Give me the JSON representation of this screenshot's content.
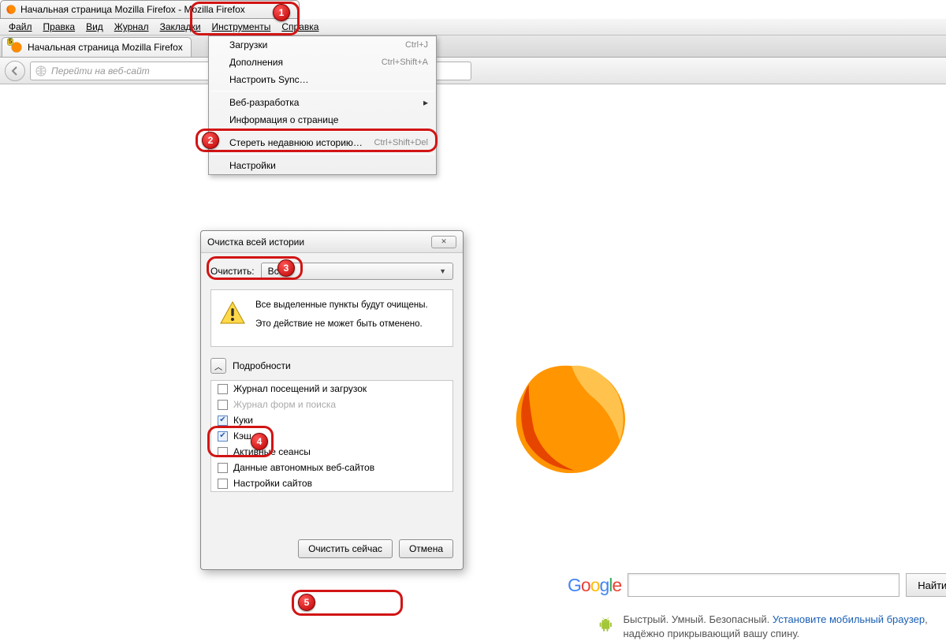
{
  "window": {
    "title": "Начальная страница Mozilla Firefox - Mozilla Firefox"
  },
  "menubar": {
    "file": "Файл",
    "edit": "Правка",
    "view": "Вид",
    "history": "Журнал",
    "bookmarks": "Закладки",
    "tools": "Инструменты",
    "help": "Справка"
  },
  "tab": {
    "label": "Начальная страница Mozilla Firefox",
    "badge": "5"
  },
  "urlbar": {
    "placeholder": "Перейти на веб-сайт"
  },
  "dropdown": {
    "downloads": {
      "label": "Загрузки",
      "shortcut": "Ctrl+J"
    },
    "addons": {
      "label": "Дополнения",
      "shortcut": "Ctrl+Shift+A"
    },
    "sync": {
      "label": "Настроить Sync…"
    },
    "webdev": {
      "label": "Веб-разработка"
    },
    "pageinfo": {
      "label": "Информация о странице"
    },
    "clearhist": {
      "label": "Стереть недавнюю историю…",
      "shortcut": "Ctrl+Shift+Del"
    },
    "prefs": {
      "label": "Настройки"
    }
  },
  "dialog": {
    "title": "Очистка всей истории",
    "clear_label": "Очистить:",
    "range": "Всё",
    "warn1": "Все выделенные пункты будут очищены.",
    "warn2": "Это действие не может быть отменено.",
    "details": "Подробности",
    "items": {
      "browsing": "Журнал посещений и загрузок",
      "forms": "Журнал форм и поиска",
      "cookies": "Куки",
      "cache": "Кэш",
      "sessions": "Активные сеансы",
      "offline": "Данные автономных веб-сайтов",
      "siteprefs": "Настройки сайтов"
    },
    "ok": "Очистить сейчас",
    "cancel": "Отмена"
  },
  "home": {
    "search_btn": "Найти",
    "promo_text": "Быстрый. Умный. Безопасный. ",
    "promo_link": "Установите мобильный браузер",
    "promo_tail": ", надёжно прикрывающий вашу спину."
  },
  "callouts": {
    "n1": "1",
    "n2": "2",
    "n3": "3",
    "n4": "4",
    "n5": "5"
  }
}
